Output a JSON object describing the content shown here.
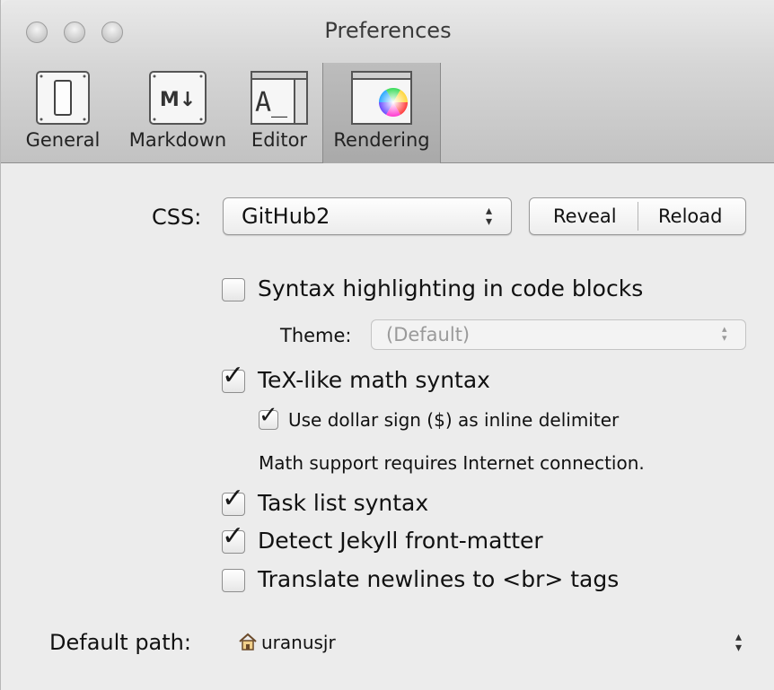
{
  "window": {
    "title": "Preferences"
  },
  "toolbar": {
    "items": [
      {
        "label": "General",
        "icon": "switch-icon"
      },
      {
        "label": "Markdown",
        "icon": "markdown-icon",
        "glyph": "M↓"
      },
      {
        "label": "Editor",
        "icon": "text-editor-icon",
        "glyph": "A_"
      },
      {
        "label": "Rendering",
        "icon": "color-wheel-icon",
        "selected": true
      }
    ]
  },
  "css": {
    "label": "CSS:",
    "value": "GitHub2",
    "reveal_label": "Reveal",
    "reload_label": "Reload"
  },
  "syntax_highlighting": {
    "label": "Syntax highlighting in code blocks",
    "checked": false,
    "theme_label": "Theme:",
    "theme_value": "(Default)"
  },
  "tex_math": {
    "label": "TeX-like math syntax",
    "checked": true,
    "dollar_label": "Use dollar sign ($) as inline delimiter",
    "dollar_checked": true,
    "note": "Math support requires Internet connection."
  },
  "task_list": {
    "label": "Task list syntax",
    "checked": true
  },
  "jekyll": {
    "label": "Detect Jekyll front-matter",
    "checked": true
  },
  "newlines": {
    "label": "Translate newlines to <br> tags",
    "checked": false
  },
  "default_path": {
    "label": "Default path:",
    "value": "uranusjr",
    "icon": "home-folder-icon"
  },
  "check_glyph": "✓"
}
